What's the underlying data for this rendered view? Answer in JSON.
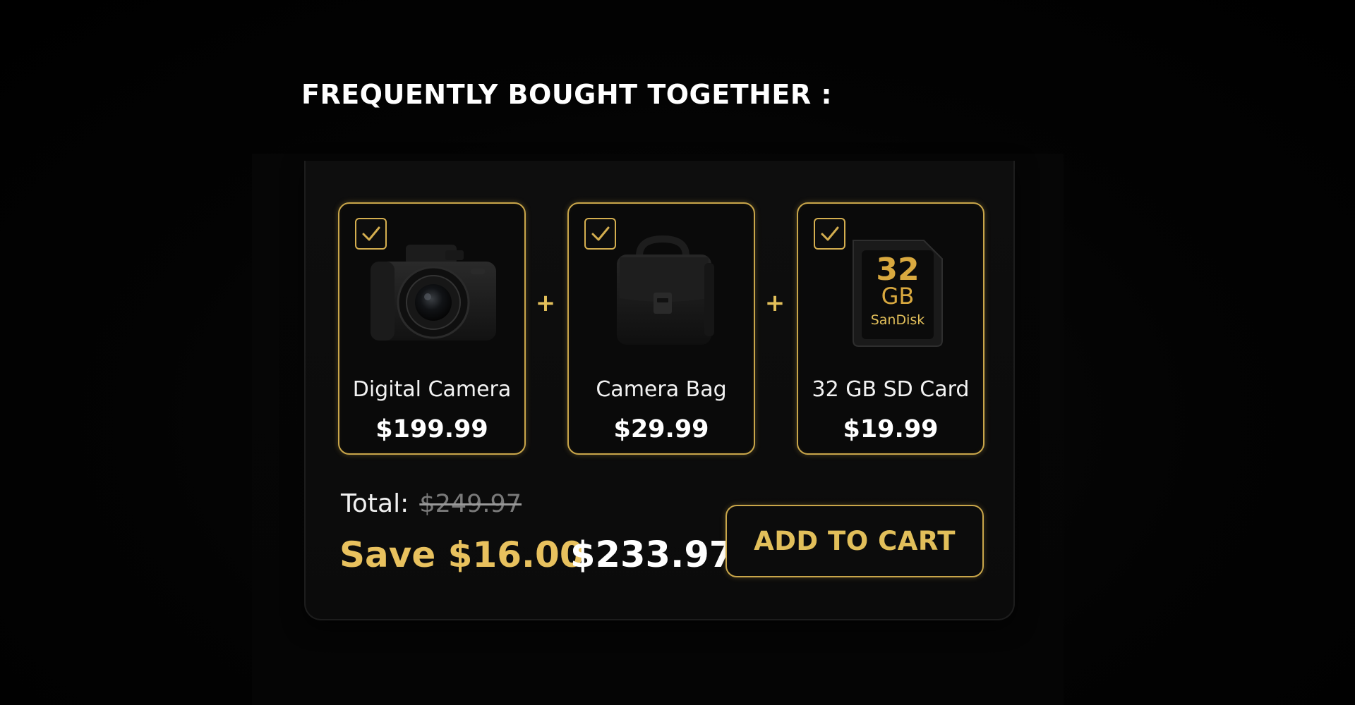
{
  "section": {
    "heading": "FREQUENTLY BOUGHT TOGETHER :"
  },
  "bundle": {
    "products": [
      {
        "name": "Digital Camera",
        "price": "$199.99",
        "checked": true,
        "icon": "camera-icon"
      },
      {
        "name": "Camera Bag",
        "price": "$29.99",
        "checked": true,
        "icon": "camera-bag-icon"
      },
      {
        "name": "32 GB SD Card",
        "price": "$19.99",
        "checked": true,
        "icon": "sd-card-icon"
      }
    ],
    "separator": "+",
    "sd_card_label": {
      "capacity": "32",
      "unit": "GB",
      "brand": "SanDisk"
    },
    "total_label": "Total:",
    "original_total": "$249.97",
    "savings": "Save $16.00",
    "final_total": "$233.97",
    "cta_label": "ADD TO CART"
  },
  "colors": {
    "accent_gold": "#c9a64a",
    "highlight_gold": "#e8c15e",
    "background": "#000000",
    "card": "#0e0e0e",
    "text_primary": "#ffffff",
    "text_muted": "#7a7a7a"
  }
}
